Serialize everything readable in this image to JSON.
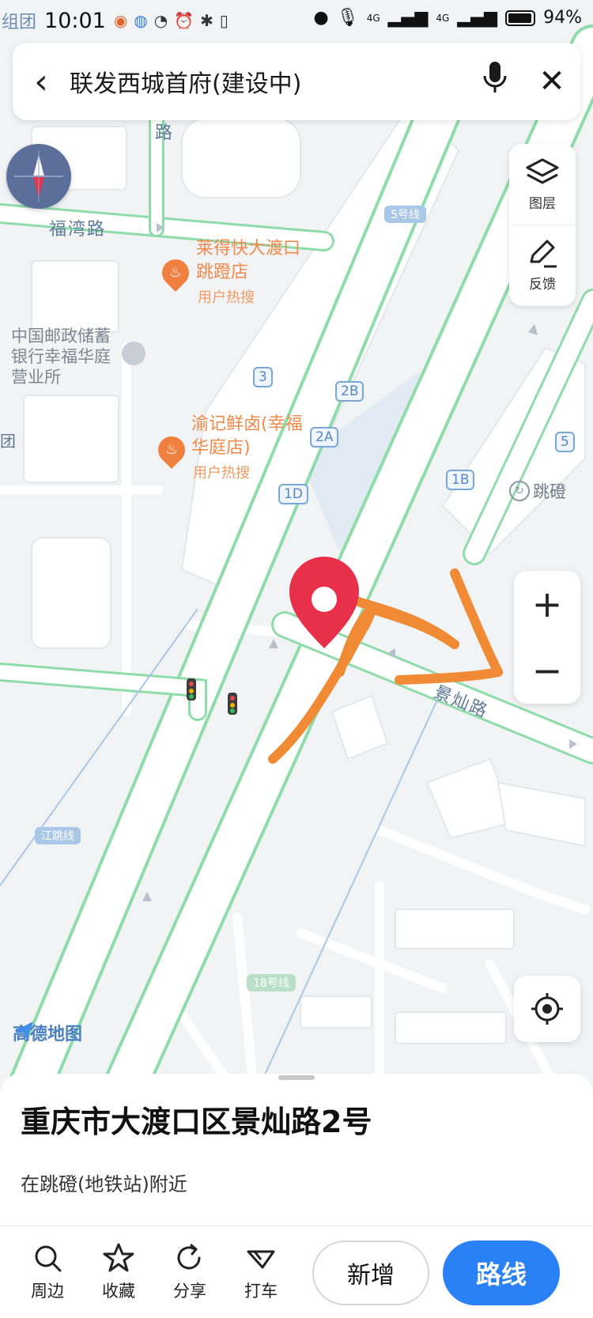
{
  "status_bar": {
    "left_tag": "组团",
    "time": "10:01",
    "network_4g_a": "4G",
    "network_4g_b": "4G",
    "battery": "94%"
  },
  "search": {
    "query": "联发西城首府(建设中)"
  },
  "tools": {
    "layers_label": "图层",
    "feedback_label": "反馈"
  },
  "map": {
    "road_fuwan": "福湾路",
    "road_fuwan_partial": "路",
    "road_jingcan": "景灿路",
    "left_edge_tag": "团",
    "poi1_name": "莱得快大渡口跳蹬店",
    "poi1_hot": "用户热搜",
    "poi2_name": "渝记鲜卤(幸福华庭店)",
    "poi2_hot": "用户热搜",
    "bank_name": "中国邮政储蓄银行幸福华庭营业所",
    "exit_3": "3",
    "exit_2b": "2B",
    "exit_2a": "2A",
    "exit_1d": "1D",
    "exit_1b": "1B",
    "exit_5": "5",
    "line5": "5号线",
    "line_jiangtiao": "江跳线",
    "line18": "18号线",
    "station": "跳磴",
    "logo": "高德地图"
  },
  "place": {
    "address": "重庆市大渡口区景灿路2号",
    "nearby": "在跳磴(地铁站)附近"
  },
  "actions": {
    "nearby": "周边",
    "favorite": "收藏",
    "share": "分享",
    "taxi": "打车",
    "add": "新增",
    "route": "路线"
  },
  "colors": {
    "road_green": "#8fdcab",
    "route_blue": "#2a80f5",
    "pin_red": "#e8304a",
    "annotation_orange": "#f08a34"
  }
}
